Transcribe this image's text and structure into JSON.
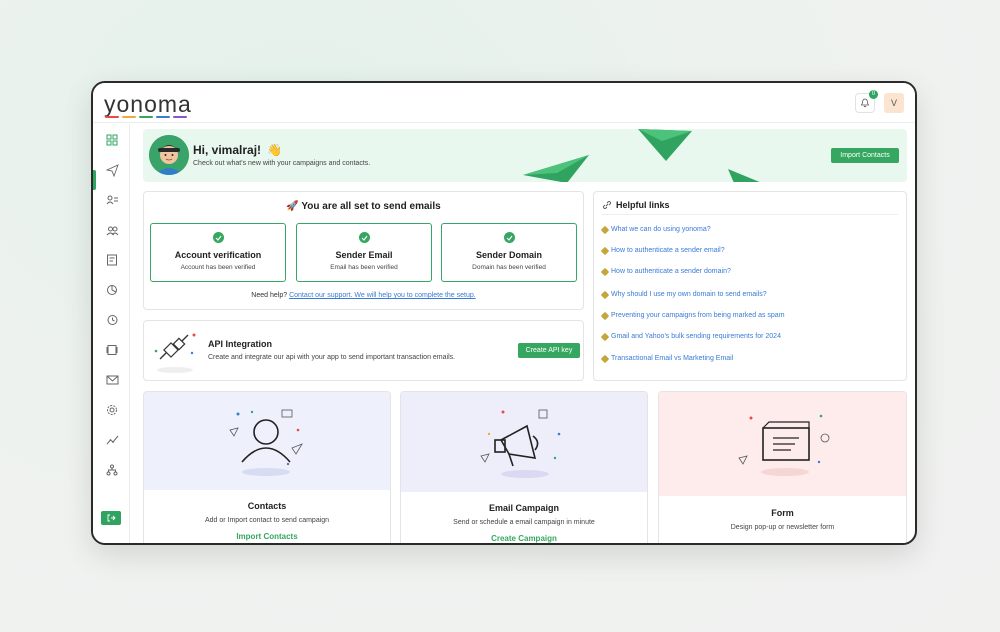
{
  "app": {
    "logo": "yonoma",
    "logo_colors": [
      "#e94b4b",
      "#f2a93b",
      "#35a760",
      "#3a7bd5",
      "#8a55c8"
    ]
  },
  "header": {
    "notification_count": "0",
    "avatar_initial": "V"
  },
  "sidebar": {
    "items": [
      "dashboard-icon",
      "send-icon",
      "contacts-list-icon",
      "audience-icon",
      "templates-icon",
      "analytics-icon",
      "history-icon",
      "media-icon",
      "mail-icon",
      "settings-icon",
      "growth-icon",
      "hierarchy-icon"
    ],
    "logout_icon": "logout-icon"
  },
  "hero": {
    "greeting": "Hi, vimalraj!",
    "wave": "👋",
    "subtitle": "Check out what's new with your campaigns and contacts.",
    "button": "Import Contacts"
  },
  "ready": {
    "title": "🚀 You are all set to send emails",
    "boxes": [
      {
        "title": "Account verification",
        "sub": "Account has been verified"
      },
      {
        "title": "Sender Email",
        "sub": "Email has been verified"
      },
      {
        "title": "Sender Domain",
        "sub": "Domain has been verified"
      }
    ],
    "help_prefix": "Need help?",
    "help_link": "Contact our support. We will help you to complete the setup."
  },
  "api": {
    "title": "API Integration",
    "subtitle": "Create and integrate our api with your app to send important transaction emails.",
    "button": "Create API key"
  },
  "helpful": {
    "title": "Helpful links",
    "links": [
      "What we can do using yonoma?",
      "How to authenticate a sender email?",
      "How to authenticate a sender domain?",
      "Why should I use my own domain to send emails?",
      "Preventing your campaigns from being marked as spam",
      "Gmail and Yahoo's bulk sending requirements for 2024",
      "Transactional Email vs Marketing Email"
    ]
  },
  "features": [
    {
      "title": "Contacts",
      "sub": "Add or Import contact to send campaign",
      "link": "Import Contacts",
      "bg": "#eef0fc"
    },
    {
      "title": "Email Campaign",
      "sub": "Send or schedule a email campaign in minute",
      "link": "Create Campaign",
      "bg": "#eeeefb"
    },
    {
      "title": "Form",
      "sub": "Design pop-up or newsletter form",
      "link": "",
      "bg": "#fdeceb"
    }
  ],
  "colors": {
    "accent": "#35a760",
    "link": "#3a7bd5",
    "hero_bg": "#e9f8ef"
  }
}
